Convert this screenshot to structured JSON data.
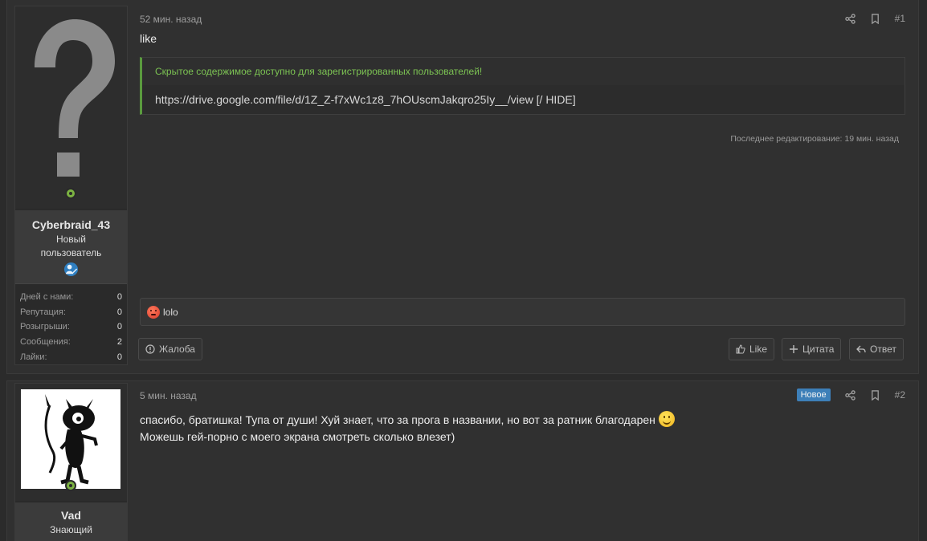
{
  "posts": [
    {
      "time": "52 мин. назад",
      "number": "#1",
      "text": "like",
      "hidden": {
        "header": "Скрытое содержимое доступно для зарегистрированных пользователей!",
        "content": "https://drive.google.com/file/d/1Z_Z-f7xWc1z8_7hOUscmJakqro25Iy__/view [/ HIDE]"
      },
      "edited": "Последнее редактирование: 19 мин. назад",
      "reaction_text": "lolo",
      "buttons": {
        "report": "Жалоба",
        "like": "Like",
        "quote": "Цитата",
        "reply": "Ответ"
      },
      "user": {
        "name": "Cyberbraid_43",
        "title_line1": "Новый",
        "title_line2": "пользователь",
        "stats": [
          {
            "label": "Дней с нами:",
            "value": "0"
          },
          {
            "label": "Репутация:",
            "value": "0"
          },
          {
            "label": "Розыгрыши:",
            "value": "0"
          },
          {
            "label": "Сообщения:",
            "value": "2"
          },
          {
            "label": "Лайки:",
            "value": "0"
          }
        ]
      }
    },
    {
      "time": "5 мин. назад",
      "number": "#2",
      "new_label": "Новое",
      "line1": "спасибо, братишка! Тупа от души! Хуй знает, что за прога в названии, но вот за ратник благодарен",
      "line2": "Можешь гей-порно с моего экрана смотреть сколько влезет)",
      "user": {
        "name": "Vad",
        "title": "Знающий"
      }
    }
  ],
  "icons": {
    "share": "share-icon",
    "bookmark": "bookmark-icon",
    "online": "online-status-icon",
    "badge": "user-badge-icon",
    "report": "report-icon",
    "like": "thumbs-up-icon",
    "quote": "plus-icon",
    "reply": "reply-icon",
    "reaction": "angry-emoji-icon",
    "smile": "smile-emoji-icon"
  },
  "colors": {
    "hidden_accent": "#5a9a3e",
    "online": "#7cb342",
    "new_badge": "#3d7fb8"
  }
}
